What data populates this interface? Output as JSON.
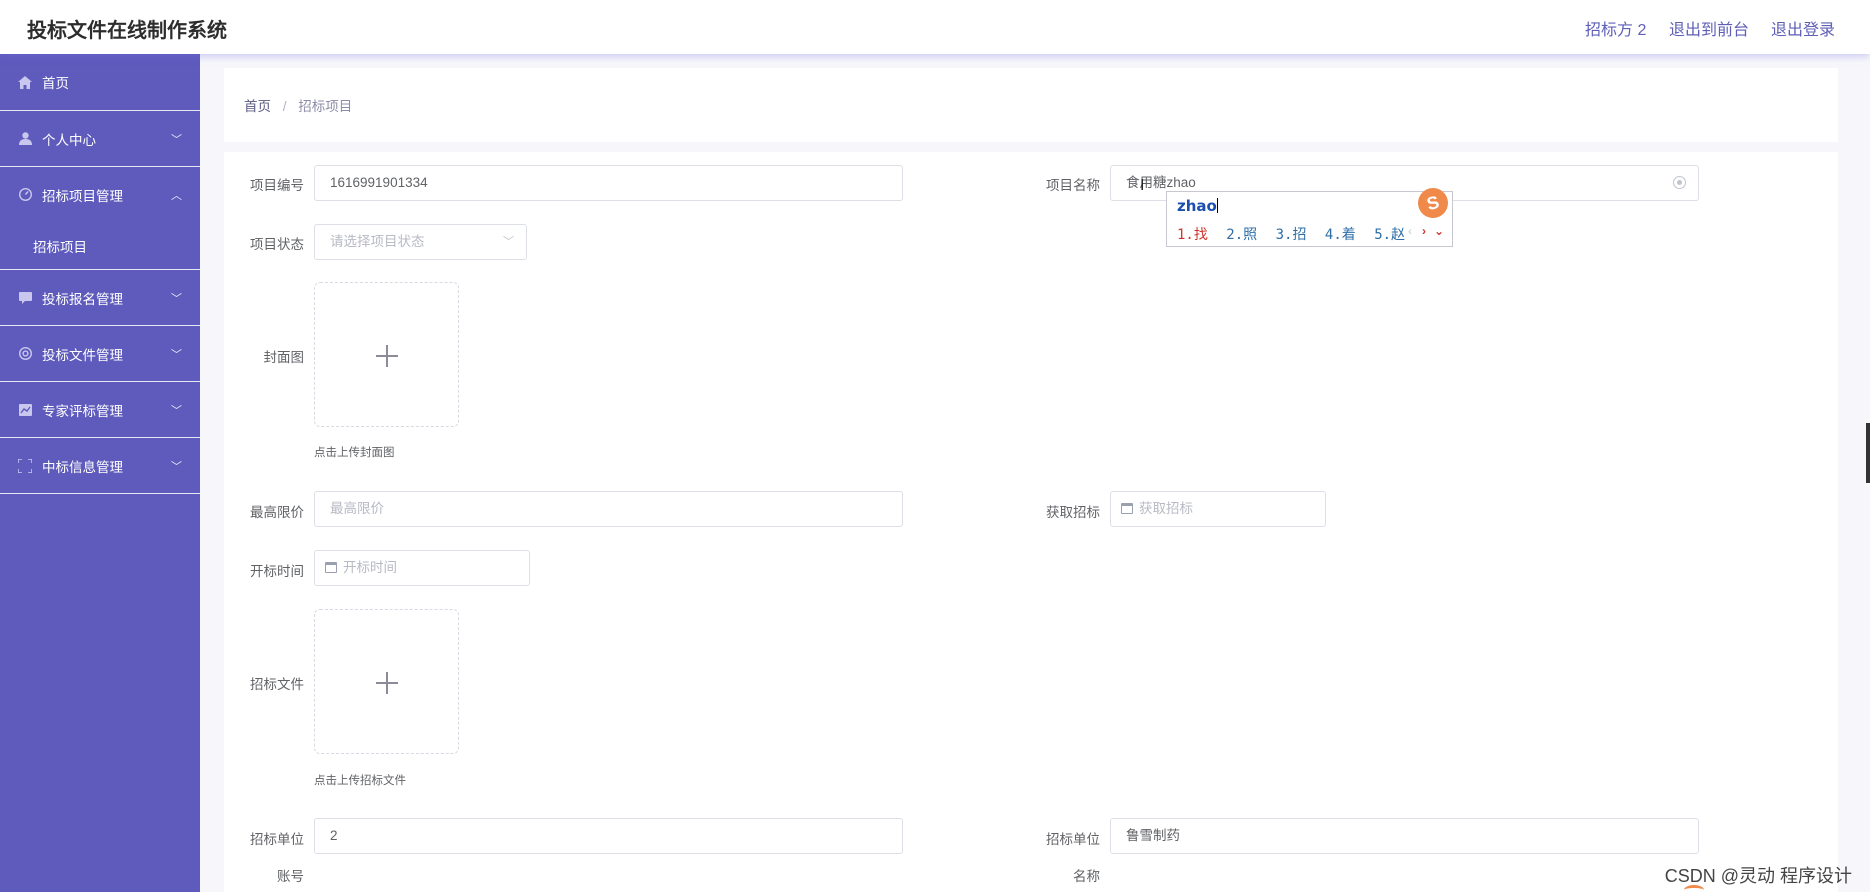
{
  "header": {
    "title": "投标文件在线制作系统",
    "links": [
      "招标方 2",
      "退出到前台",
      "退出登录"
    ]
  },
  "sidebar": {
    "items": [
      {
        "label": "首页",
        "icon": "home-icon",
        "expanded": null
      },
      {
        "label": "个人中心",
        "icon": "user-icon",
        "expanded": false
      },
      {
        "label": "招标项目管理",
        "icon": "project-icon",
        "expanded": true
      },
      {
        "label": "招标项目",
        "sub": true
      },
      {
        "label": "投标报名管理",
        "icon": "signup-icon",
        "expanded": false
      },
      {
        "label": "投标文件管理",
        "icon": "document-icon",
        "expanded": false
      },
      {
        "label": "专家评标管理",
        "icon": "review-icon",
        "expanded": false
      },
      {
        "label": "中标信息管理",
        "icon": "award-icon",
        "expanded": false
      }
    ]
  },
  "breadcrumb": {
    "home": "首页",
    "separator": "/",
    "current": "招标项目"
  },
  "form": {
    "project_no": {
      "label": "项目编号",
      "value": "1616991901334"
    },
    "project_name": {
      "label": "项目名称",
      "value": "食用糖zhao"
    },
    "project_status": {
      "label": "项目状态",
      "placeholder": "请选择项目状态"
    },
    "cover": {
      "label": "封面图",
      "hint": "点击上传封面图"
    },
    "max_price": {
      "label": "最高限价",
      "placeholder": "最高限价"
    },
    "get_bid": {
      "label": "获取招标",
      "placeholder": "获取招标"
    },
    "open_time": {
      "label": "开标时间",
      "placeholder": "开标时间"
    },
    "bid_file": {
      "label": "招标文件",
      "hint": "点击上传招标文件"
    },
    "unit_account": {
      "label": "招标单位",
      "label2": "账号",
      "value": "2"
    },
    "unit_name": {
      "label": "招标单位",
      "label2": "名称",
      "value": "鲁雪制药"
    }
  },
  "ime": {
    "pinyin": "zhao",
    "candidates": [
      "1.找",
      "2.照",
      "3.招",
      "4.着",
      "5.赵"
    ],
    "logo": "S",
    "prev": "‹",
    "next": "›",
    "more": "⌄"
  },
  "watermark": "CSDN @灵动 程序设计"
}
